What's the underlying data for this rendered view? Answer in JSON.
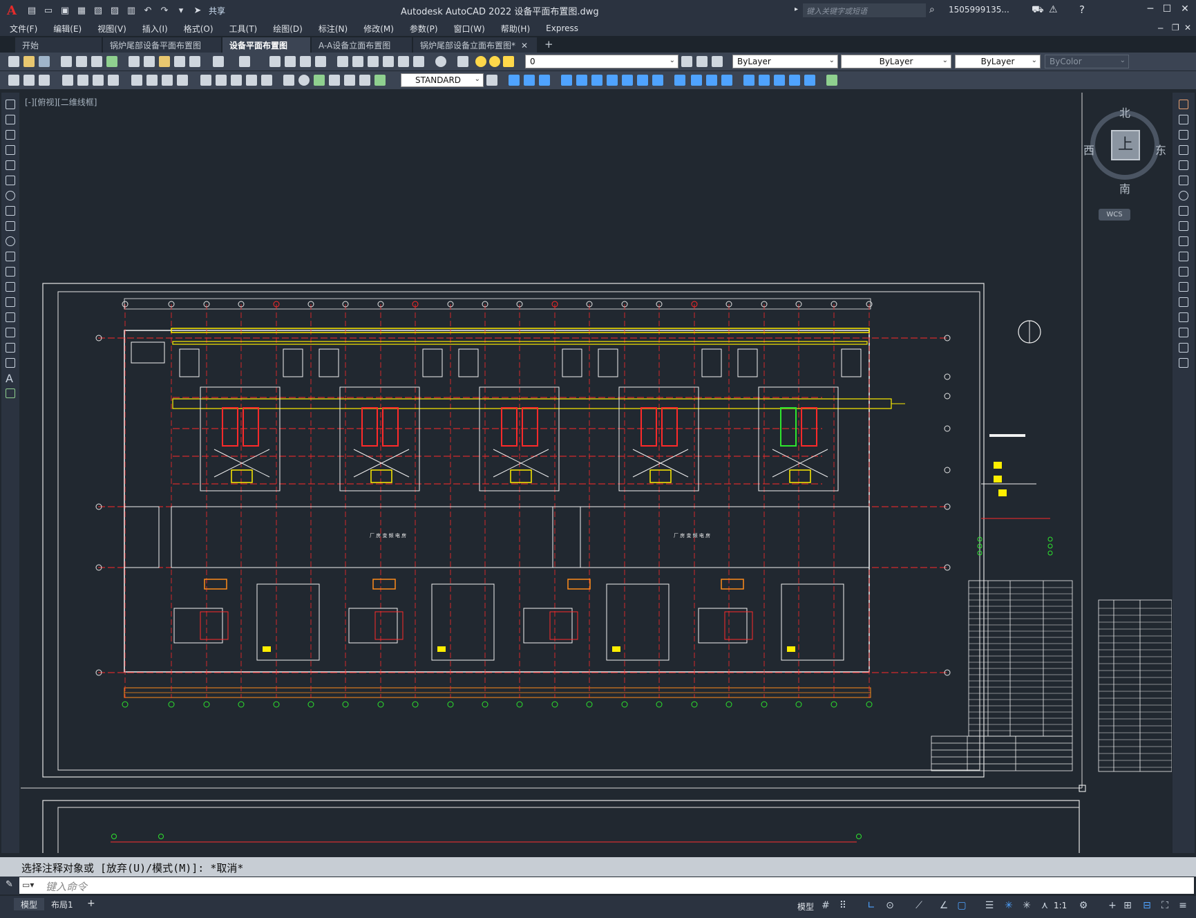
{
  "app": {
    "logo": "A",
    "title": "Autodesk AutoCAD 2022    设备平面布置图.dwg",
    "share_label": "共享",
    "search_placeholder": "键入关键字或短语",
    "user_name": "1505999135..."
  },
  "menu": [
    "文件(F)",
    "编辑(E)",
    "视图(V)",
    "插入(I)",
    "格式(O)",
    "工具(T)",
    "绘图(D)",
    "标注(N)",
    "修改(M)",
    "参数(P)",
    "窗口(W)",
    "帮助(H)",
    "Express"
  ],
  "tabs": [
    {
      "label": "开始",
      "active": false,
      "closable": false
    },
    {
      "label": "锅炉尾部设备平面布置图",
      "active": false,
      "closable": false
    },
    {
      "label": "设备平面布置图*",
      "active": true,
      "closable": true
    },
    {
      "label": "A-A设备立面布置图*",
      "active": false,
      "closable": true
    },
    {
      "label": "锅炉尾部设备立面布置图*",
      "active": false,
      "closable": true
    }
  ],
  "toolbar": {
    "layer_value": "0",
    "color_value": "ByLayer",
    "linetype_value": "ByLayer",
    "lineweight_value": "ByLayer",
    "plotstyle_value": "ByColor",
    "textstyle_value": "STANDARD"
  },
  "viewport": {
    "label": "[-][俯视][二维线框]"
  },
  "viewcube": {
    "top_face": "上",
    "north": "北",
    "south": "南",
    "east": "东",
    "west": "西",
    "wcs": "WCS"
  },
  "drawing": {
    "hall_label_left": "厂 房 变 频 电 房",
    "hall_label_right": "厂 房 变 频 电 房"
  },
  "command": {
    "history": "选择注释对象或 [放弃(U)/模式(M)]: *取消*",
    "placeholder": "键入命令"
  },
  "status": {
    "layout_tabs": [
      "模型",
      "布局1"
    ],
    "model_label": "模型",
    "scale": "1:1"
  },
  "colors": {
    "background": "#212830",
    "red": "#ff2a2a",
    "yellow": "#ffee00",
    "white": "#f2f2f2",
    "green": "#2ee52e"
  }
}
